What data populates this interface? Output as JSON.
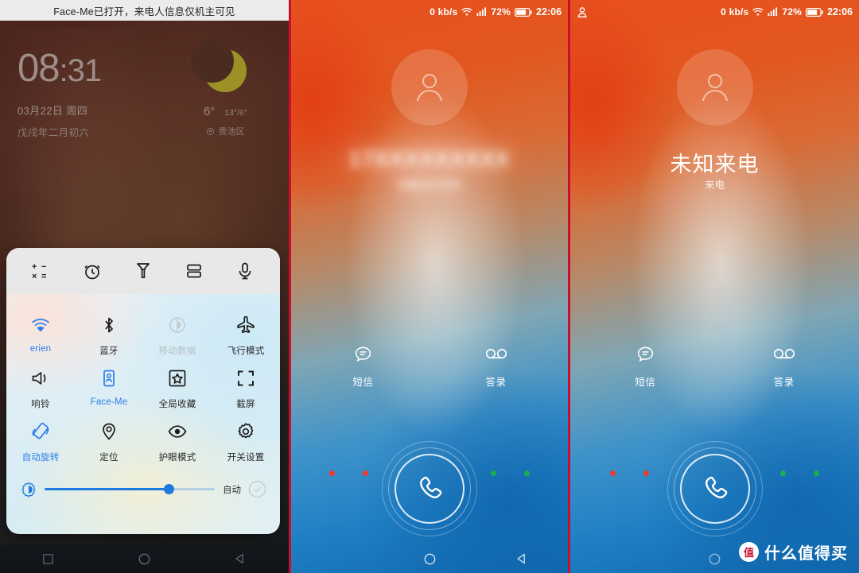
{
  "lockscreen": {
    "notification_banner": "Face-Me已打开，来电人信息仅机主可见",
    "clock_hour": "08",
    "clock_minute": ":31",
    "date": "03月22日  周四",
    "lunar_date": "戊戌年二月初六",
    "weather": {
      "current_temp": "6°",
      "range": "13°/6°",
      "location": "贵池区"
    }
  },
  "quick_settings": {
    "shortcuts": [
      {
        "name": "calculator-icon",
        "label": "计算器"
      },
      {
        "name": "alarm-icon",
        "label": "闹钟"
      },
      {
        "name": "flashlight-icon",
        "label": "手电筒"
      },
      {
        "name": "split-screen-icon",
        "label": "分屏"
      },
      {
        "name": "voice-recorder-icon",
        "label": "录音机"
      }
    ],
    "toggles": [
      {
        "label": "erien",
        "state": "on",
        "icon": "wifi-icon"
      },
      {
        "label": "蓝牙",
        "state": "off-normal",
        "icon": "bluetooth-icon"
      },
      {
        "label": "移动数据",
        "state": "disabled",
        "icon": "mobile-data-icon"
      },
      {
        "label": "飞行模式",
        "state": "off-normal",
        "icon": "airplane-icon"
      },
      {
        "label": "响铃",
        "state": "off-normal",
        "icon": "ringer-icon"
      },
      {
        "label": "Face-Me",
        "state": "on",
        "icon": "face-me-icon"
      },
      {
        "label": "全局收藏",
        "state": "off-normal",
        "icon": "star-box-icon"
      },
      {
        "label": "截屏",
        "state": "off-normal",
        "icon": "screenshot-icon"
      },
      {
        "label": "自动旋转",
        "state": "on",
        "icon": "auto-rotate-icon"
      },
      {
        "label": "定位",
        "state": "off-normal",
        "icon": "location-icon"
      },
      {
        "label": "护眼模式",
        "state": "off-normal",
        "icon": "eye-comfort-icon"
      },
      {
        "label": "开关设置",
        "state": "off-normal",
        "icon": "gear-icon"
      }
    ],
    "brightness": {
      "value_percent": "73",
      "auto_label": "自动",
      "auto_enabled": "false"
    }
  },
  "call_screen_middle": {
    "statusbar": {
      "network_speed": "0 kb/s",
      "battery_percent": "72%",
      "time": "22:06"
    },
    "caller_name": "17XXXXXXXXX",
    "caller_sub": "安徽池州 移动",
    "actions": [
      {
        "label": "短信",
        "icon": "sms-icon"
      },
      {
        "label": "答录",
        "icon": "voicemail-icon"
      }
    ],
    "answer_icon": "phone-handset-icon"
  },
  "call_screen_right": {
    "statusbar": {
      "network_speed": "0 kb/s",
      "battery_percent": "72%",
      "time": "22:06",
      "left_icon": "contact-icon"
    },
    "caller_name": "未知来电",
    "caller_sub": "来电",
    "actions": [
      {
        "label": "短信",
        "icon": "sms-icon"
      },
      {
        "label": "答录",
        "icon": "voicemail-icon"
      }
    ],
    "answer_icon": "phone-handset-icon"
  },
  "navigation": {
    "recents": "recents-square-icon",
    "home": "home-circle-icon",
    "back": "back-triangle-icon"
  },
  "watermark": {
    "badge": "值",
    "text": "什么值得买"
  },
  "colors": {
    "accent_blue": "#1f7ae0",
    "decline_red": "#f0392b",
    "answer_green": "#18b14b",
    "seam_red": "#c8102e"
  }
}
